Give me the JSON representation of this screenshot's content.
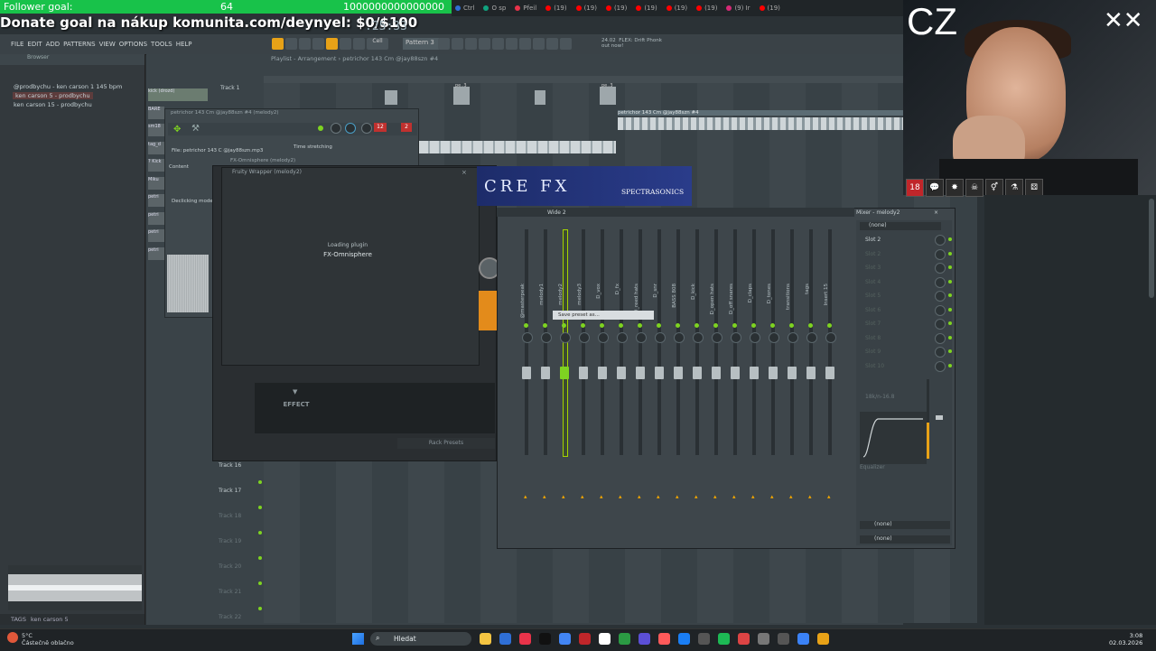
{
  "overlay": {
    "follower_label": "Follower goal:",
    "follower_count": "64",
    "follower_target": "1000000000000000",
    "donate_text": "Donate goal na nákup komunita.com/deynyel: $0/$100",
    "clock": ".25:33"
  },
  "browser_tabs": [
    {
      "label": "Ctrl",
      "color": "#2f6fd6"
    },
    {
      "label": "O sp",
      "color": "#10a37f"
    },
    {
      "label": "Pfeil",
      "color": "#e8334a"
    },
    {
      "label": "(19)",
      "color": "#ff0000"
    },
    {
      "label": "(19)",
      "color": "#ff0000"
    },
    {
      "label": "(19)",
      "color": "#ff0000"
    },
    {
      "label": "(19)",
      "color": "#ff0000"
    },
    {
      "label": "(19)",
      "color": "#ff0000"
    },
    {
      "label": "(19)",
      "color": "#ff0000"
    },
    {
      "label": "(9) Ir",
      "color": "#d62976"
    },
    {
      "label": "(19)",
      "color": "#ff0000"
    }
  ],
  "fl": {
    "menu": [
      "FILE",
      "EDIT",
      "ADD",
      "PATTERNS",
      "VIEW",
      "OPTIONS",
      "TOOLS",
      "HELP"
    ],
    "pattern": "Pattern 3",
    "hint": "24.02  FLEX: Drift Phonk\nout now!",
    "cell_label": "Cell"
  },
  "browser": {
    "header": "Browser",
    "items": [
      {
        "label": "@prodbychu - ken carson 1 145 bpm",
        "selected": false
      },
      {
        "label": "ken carson 5 - prodbychu",
        "selected": true
      },
      {
        "label": "ken carson 15 - prodbychu",
        "selected": false
      }
    ],
    "tags_label": "TAGS",
    "preview_name": "ken carson 5"
  },
  "playlist": {
    "title": "Playlist - Arrangement › petrichor 143 Cm @jay88szn #4",
    "tracks": [
      "Track 1",
      "Track 16",
      "Track 17",
      "Track 18",
      "Track 19",
      "Track 20",
      "Track 21",
      "Track 22"
    ],
    "clips": [
      "pe..3",
      "pe..3",
      "petrichor 143 Cm @jay88szn #4"
    ]
  },
  "channel": {
    "title": "petrichor 143 Cm @jay88szn #4 (melody2)",
    "file_label": "File: petrichor 143 C @jay88szn.mp3",
    "time_stretching": "Time stretching",
    "content_label": "Content",
    "declicking": "Declicking mode",
    "track_num": "2",
    "pitch_num": "12",
    "left_items": [
      "kick (drozd)",
      "BARE",
      "sm18",
      "tag_d",
      "? Kick",
      "Miku",
      "petri",
      "petri",
      "petri",
      "petri"
    ]
  },
  "wrapper": {
    "outer_title": "FX-Omnisphere (melody2)",
    "title": "Fruity Wrapper (melody2)",
    "loading": "Loading plugin",
    "plugin": "FX-Omnisphere",
    "effect": "EFFECT",
    "rack_presets": "Rack Presets",
    "banner": "CRE FX",
    "brand": "SPECTRASONICS"
  },
  "mixer": {
    "title": "Wide 2",
    "title2": "Mixer - melody2",
    "tooltip": "Save preset as...",
    "strips": [
      {
        "name": "@masterpeak",
        "selected": false
      },
      {
        "name": "melody1",
        "selected": false
      },
      {
        "name": "melody2",
        "selected": true
      },
      {
        "name": "melody3",
        "selected": false
      },
      {
        "name": "D_vox",
        "selected": false
      },
      {
        "name": "D_fx",
        "selected": false
      },
      {
        "name": "D_reed hats",
        "selected": false
      },
      {
        "name": "D_snr",
        "selected": false
      },
      {
        "name": "BASS 808",
        "selected": false
      },
      {
        "name": "D_kick",
        "selected": false
      },
      {
        "name": "D_open hats",
        "selected": false
      },
      {
        "name": "D_off snares",
        "selected": false
      },
      {
        "name": "D_claps",
        "selected": false
      },
      {
        "name": "D_tones",
        "selected": false
      },
      {
        "name": "transitions",
        "selected": false
      },
      {
        "name": "tags",
        "selected": false
      },
      {
        "name": "Insert 15",
        "selected": false
      }
    ],
    "slots": [
      "(none)",
      "Slot 2",
      "Slot 2",
      "Slot 3",
      "Slot 4",
      "Slot 5",
      "Slot 6",
      "Slot 7",
      "Slot 8",
      "Slot 9",
      "Slot 10"
    ],
    "eq_label": "18k/n-16.8",
    "equalizer": "Equalizer",
    "out1": "(none)",
    "out2": "(none)"
  },
  "cam": {
    "lang": "CZ",
    "age": "18"
  },
  "taskbar": {
    "temp": "5°C",
    "weather": "Částečně oblačno",
    "search": "Hledat",
    "time": "3:08",
    "date": "02.03.2026"
  },
  "colors": {
    "accent": "#7ed321",
    "overlay_green": "#18c24a",
    "route_orange": "#f0a500"
  }
}
